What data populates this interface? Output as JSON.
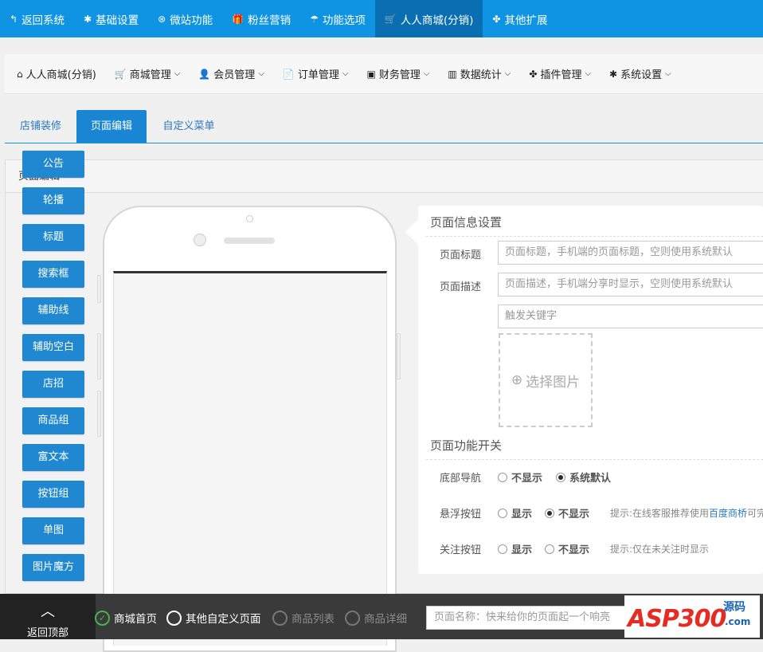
{
  "topnav": [
    {
      "icon": "↰",
      "icon_name": "back-arrow-icon",
      "label": "返回系统"
    },
    {
      "icon": "✱",
      "icon_name": "gear-icon",
      "label": "基础设置"
    },
    {
      "icon": "⊛",
      "icon_name": "lifebuoy-icon",
      "label": "微站功能"
    },
    {
      "icon": "🎁",
      "icon_name": "gift-icon",
      "label": "粉丝营销"
    },
    {
      "icon": "☂",
      "icon_name": "umbrella-icon",
      "label": "功能选项"
    },
    {
      "icon": "🛒",
      "icon_name": "cart-icon",
      "label": "人人商城(分销)",
      "active": true
    },
    {
      "icon": "✤",
      "icon_name": "cubes-icon",
      "label": "其他扩展"
    }
  ],
  "subnav": [
    {
      "icon": "⌂",
      "icon_name": "home-icon",
      "label": "人人商城(分销)",
      "caret": false
    },
    {
      "icon": "🛒",
      "icon_name": "cart-icon",
      "label": "商城管理",
      "caret": true
    },
    {
      "icon": "👤",
      "icon_name": "user-icon",
      "label": "会员管理",
      "caret": true
    },
    {
      "icon": "📄",
      "icon_name": "file-icon",
      "label": "订单管理",
      "caret": true
    },
    {
      "icon": "▣",
      "icon_name": "money-icon",
      "label": "财务管理",
      "caret": true
    },
    {
      "icon": "▥",
      "icon_name": "bar-chart-icon",
      "label": "数据统计",
      "caret": true
    },
    {
      "icon": "✤",
      "icon_name": "cubes-icon",
      "label": "插件管理",
      "caret": true
    },
    {
      "icon": "✱",
      "icon_name": "gear-icon",
      "label": "系统设置",
      "caret": true
    }
  ],
  "tabs": {
    "t1": "店铺装修",
    "t2": "页面编辑",
    "t3": "自定义菜单"
  },
  "panel_title": "页面编辑",
  "widgets": [
    "公告",
    "轮播",
    "标题",
    "搜索框",
    "辅助线",
    "辅助空白",
    "店招",
    "商品组",
    "富文本",
    "按钮组",
    "单图",
    "图片魔方"
  ],
  "info": {
    "section1": "页面信息设置",
    "title_label": "页面标题",
    "title_placeholder": "页面标题，手机端的页面标题，空则使用系统默认",
    "desc_label": "页面描述",
    "desc_placeholder": "页面描述，手机端分享时显示，空则使用系统默认",
    "keyword_placeholder": "触发关键字",
    "choose_image": "选择图片",
    "section2": "页面功能开关",
    "bottom_nav_label": "底部导航",
    "bottom_nav_opt1": "不显示",
    "bottom_nav_opt2": "系统默认",
    "float_btn_label": "悬浮按钮",
    "float_opt1": "显示",
    "float_opt2": "不显示",
    "float_hint_prefix": "提示:在线客服推荐使用",
    "float_hint_link": "百度商桥",
    "float_hint_suffix": "可完",
    "follow_label": "关注按钮",
    "follow_opt1": "显示",
    "follow_opt2": "不显示",
    "follow_hint": "提示:仅在未关注时显示"
  },
  "bottom": {
    "back_top": "返回顶部",
    "opt_home": "商城首页",
    "opt_custom": "其他自定义页面",
    "opt_list": "商品列表",
    "opt_detail": "商品详细",
    "page_name_placeholder": "页面名称：快来给你的页面起一个响亮",
    "logo_main": "ASP300",
    "logo_sub": "源码",
    "logo_com": ".com"
  },
  "colors": {
    "topbar": "#0f94e3",
    "topbar_active": "#0a6fb2",
    "widget_button": "#1f88d0",
    "bottom_bar": "#3a3a3a"
  }
}
